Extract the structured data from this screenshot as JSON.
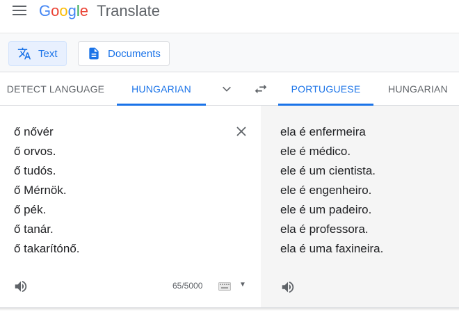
{
  "header": {
    "logo_google": "Google",
    "logo_product": "Translate",
    "brand_colors": [
      "#4285f4",
      "#ea4335",
      "#fbbc05",
      "#4285f4",
      "#34a853",
      "#ea4335"
    ]
  },
  "modes": [
    {
      "label": "Text",
      "icon": "translate-icon",
      "active": true
    },
    {
      "label": "Documents",
      "icon": "document-icon",
      "active": false
    }
  ],
  "source_langs": {
    "detect": "DETECT LANGUAGE",
    "selected": "HUNGARIAN"
  },
  "target_langs": {
    "selected": "PORTUGUESE",
    "other": "HUNGARIAN"
  },
  "source_text": [
    "ő nővér",
    "ő orvos.",
    "ő tudós.",
    "ő Mérnök.",
    "ő pék.",
    "ő tanár.",
    "ő takarítónő."
  ],
  "target_text": [
    "ela é enfermeira",
    "ele é médico.",
    "ele é um cientista.",
    "ele é engenheiro.",
    "ele é um padeiro.",
    "ela é professora.",
    "ela é uma faxineira."
  ],
  "char_count": "65/5000",
  "colors": {
    "accent": "#1a73e8",
    "text": "#202124",
    "muted": "#5f6368",
    "target_bg": "#f5f5f5"
  }
}
